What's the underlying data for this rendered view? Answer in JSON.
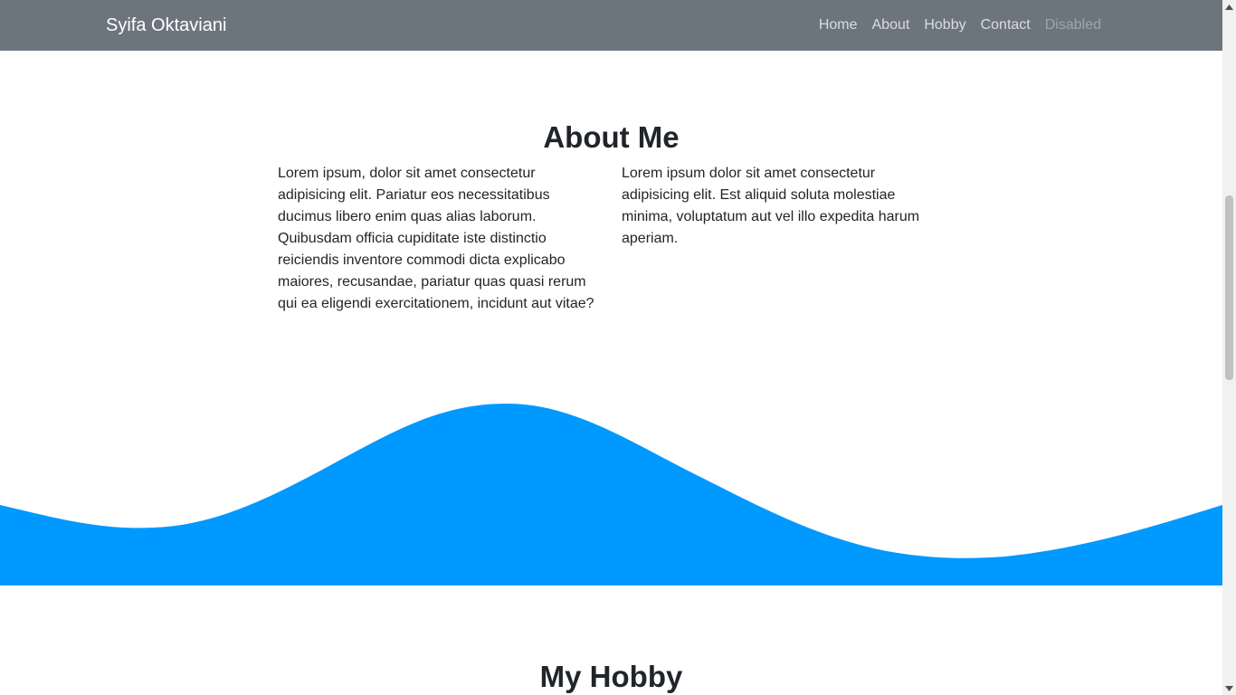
{
  "navbar": {
    "brand": "Syifa Oktaviani",
    "links": [
      {
        "label": "Home"
      },
      {
        "label": "About"
      },
      {
        "label": "Hobby"
      },
      {
        "label": "Contact"
      },
      {
        "label": "Disabled"
      }
    ],
    "background": "#6c757d"
  },
  "about": {
    "title": "About Me",
    "paragraphs": [
      "Lorem ipsum, dolor sit amet consectetur adipisicing elit. Pariatur eos necessitatibus ducimus libero enim quas alias laborum. Quibusdam officia cupiditate iste distinctio reiciendis inventore commodi dicta explicabo maiores, recusandae, pariatur quas quasi rerum qui ea eligendi exercitationem, incidunt aut vitae?",
      "Lorem ipsum dolor sit amet consectetur adipisicing elit. Est aliquid soluta molestiae minima, voluptatum aut vel illo expedita harum aperiam."
    ]
  },
  "wave": {
    "color": "#0099ff"
  },
  "hobby": {
    "title": "My Hobby"
  },
  "icons": {
    "scroll_up": "scroll-up-arrow-icon",
    "scroll_down": "scroll-down-arrow-icon"
  }
}
